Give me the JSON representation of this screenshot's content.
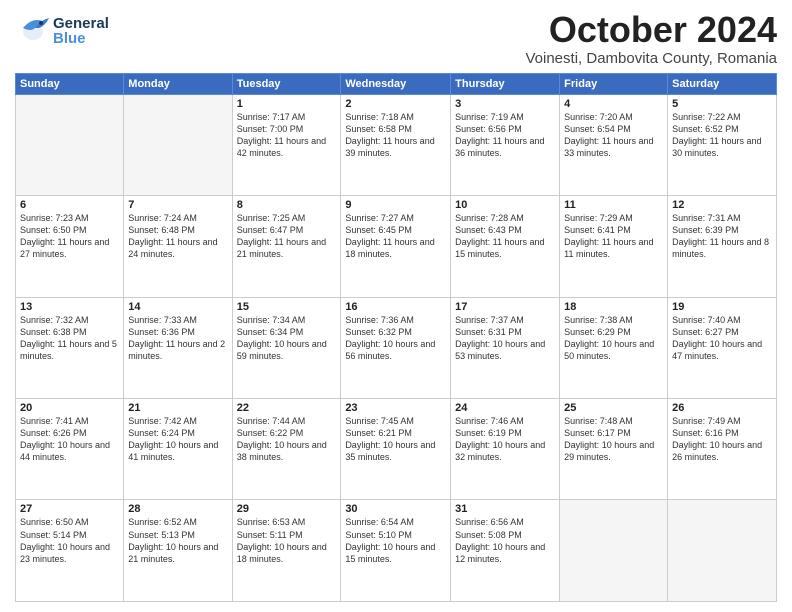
{
  "header": {
    "logo_general": "General",
    "logo_blue": "Blue",
    "month_title": "October 2024",
    "location": "Voinesti, Dambovita County, Romania"
  },
  "weekdays": [
    "Sunday",
    "Monday",
    "Tuesday",
    "Wednesday",
    "Thursday",
    "Friday",
    "Saturday"
  ],
  "weeks": [
    [
      {
        "day": "",
        "detail": ""
      },
      {
        "day": "",
        "detail": ""
      },
      {
        "day": "1",
        "detail": "Sunrise: 7:17 AM\nSunset: 7:00 PM\nDaylight: 11 hours and 42 minutes."
      },
      {
        "day": "2",
        "detail": "Sunrise: 7:18 AM\nSunset: 6:58 PM\nDaylight: 11 hours and 39 minutes."
      },
      {
        "day": "3",
        "detail": "Sunrise: 7:19 AM\nSunset: 6:56 PM\nDaylight: 11 hours and 36 minutes."
      },
      {
        "day": "4",
        "detail": "Sunrise: 7:20 AM\nSunset: 6:54 PM\nDaylight: 11 hours and 33 minutes."
      },
      {
        "day": "5",
        "detail": "Sunrise: 7:22 AM\nSunset: 6:52 PM\nDaylight: 11 hours and 30 minutes."
      }
    ],
    [
      {
        "day": "6",
        "detail": "Sunrise: 7:23 AM\nSunset: 6:50 PM\nDaylight: 11 hours and 27 minutes."
      },
      {
        "day": "7",
        "detail": "Sunrise: 7:24 AM\nSunset: 6:48 PM\nDaylight: 11 hours and 24 minutes."
      },
      {
        "day": "8",
        "detail": "Sunrise: 7:25 AM\nSunset: 6:47 PM\nDaylight: 11 hours and 21 minutes."
      },
      {
        "day": "9",
        "detail": "Sunrise: 7:27 AM\nSunset: 6:45 PM\nDaylight: 11 hours and 18 minutes."
      },
      {
        "day": "10",
        "detail": "Sunrise: 7:28 AM\nSunset: 6:43 PM\nDaylight: 11 hours and 15 minutes."
      },
      {
        "day": "11",
        "detail": "Sunrise: 7:29 AM\nSunset: 6:41 PM\nDaylight: 11 hours and 11 minutes."
      },
      {
        "day": "12",
        "detail": "Sunrise: 7:31 AM\nSunset: 6:39 PM\nDaylight: 11 hours and 8 minutes."
      }
    ],
    [
      {
        "day": "13",
        "detail": "Sunrise: 7:32 AM\nSunset: 6:38 PM\nDaylight: 11 hours and 5 minutes."
      },
      {
        "day": "14",
        "detail": "Sunrise: 7:33 AM\nSunset: 6:36 PM\nDaylight: 11 hours and 2 minutes."
      },
      {
        "day": "15",
        "detail": "Sunrise: 7:34 AM\nSunset: 6:34 PM\nDaylight: 10 hours and 59 minutes."
      },
      {
        "day": "16",
        "detail": "Sunrise: 7:36 AM\nSunset: 6:32 PM\nDaylight: 10 hours and 56 minutes."
      },
      {
        "day": "17",
        "detail": "Sunrise: 7:37 AM\nSunset: 6:31 PM\nDaylight: 10 hours and 53 minutes."
      },
      {
        "day": "18",
        "detail": "Sunrise: 7:38 AM\nSunset: 6:29 PM\nDaylight: 10 hours and 50 minutes."
      },
      {
        "day": "19",
        "detail": "Sunrise: 7:40 AM\nSunset: 6:27 PM\nDaylight: 10 hours and 47 minutes."
      }
    ],
    [
      {
        "day": "20",
        "detail": "Sunrise: 7:41 AM\nSunset: 6:26 PM\nDaylight: 10 hours and 44 minutes."
      },
      {
        "day": "21",
        "detail": "Sunrise: 7:42 AM\nSunset: 6:24 PM\nDaylight: 10 hours and 41 minutes."
      },
      {
        "day": "22",
        "detail": "Sunrise: 7:44 AM\nSunset: 6:22 PM\nDaylight: 10 hours and 38 minutes."
      },
      {
        "day": "23",
        "detail": "Sunrise: 7:45 AM\nSunset: 6:21 PM\nDaylight: 10 hours and 35 minutes."
      },
      {
        "day": "24",
        "detail": "Sunrise: 7:46 AM\nSunset: 6:19 PM\nDaylight: 10 hours and 32 minutes."
      },
      {
        "day": "25",
        "detail": "Sunrise: 7:48 AM\nSunset: 6:17 PM\nDaylight: 10 hours and 29 minutes."
      },
      {
        "day": "26",
        "detail": "Sunrise: 7:49 AM\nSunset: 6:16 PM\nDaylight: 10 hours and 26 minutes."
      }
    ],
    [
      {
        "day": "27",
        "detail": "Sunrise: 6:50 AM\nSunset: 5:14 PM\nDaylight: 10 hours and 23 minutes."
      },
      {
        "day": "28",
        "detail": "Sunrise: 6:52 AM\nSunset: 5:13 PM\nDaylight: 10 hours and 21 minutes."
      },
      {
        "day": "29",
        "detail": "Sunrise: 6:53 AM\nSunset: 5:11 PM\nDaylight: 10 hours and 18 minutes."
      },
      {
        "day": "30",
        "detail": "Sunrise: 6:54 AM\nSunset: 5:10 PM\nDaylight: 10 hours and 15 minutes."
      },
      {
        "day": "31",
        "detail": "Sunrise: 6:56 AM\nSunset: 5:08 PM\nDaylight: 10 hours and 12 minutes."
      },
      {
        "day": "",
        "detail": ""
      },
      {
        "day": "",
        "detail": ""
      }
    ]
  ]
}
